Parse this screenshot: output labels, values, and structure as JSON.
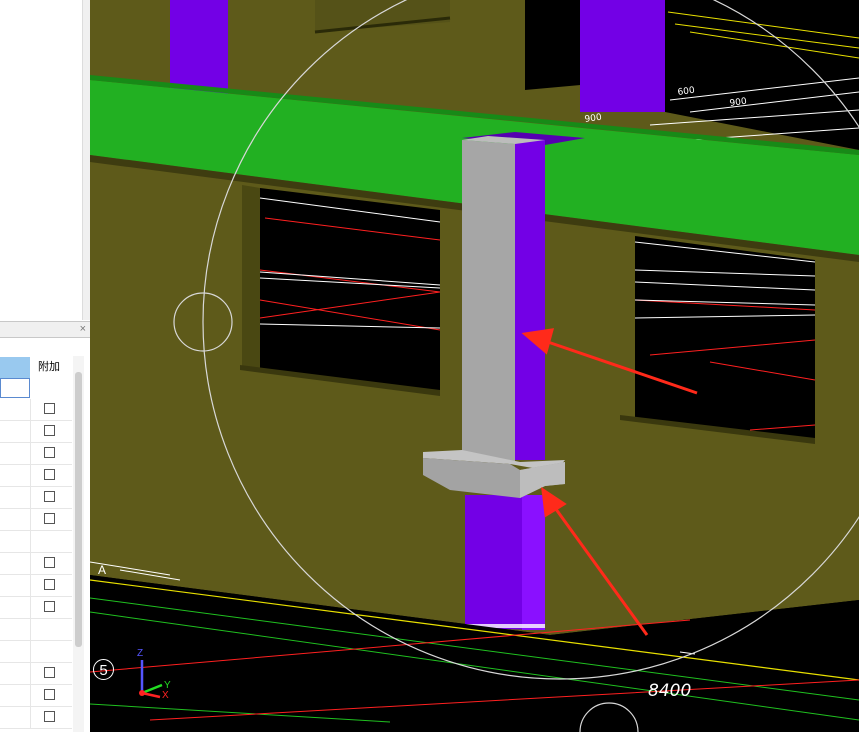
{
  "properties_panel": {
    "close_glyph": "×",
    "column_header_additional": "附加",
    "rows": [
      {
        "checkbox": true
      },
      {
        "checkbox": true
      },
      {
        "checkbox": true
      },
      {
        "checkbox": true
      },
      {
        "checkbox": true
      },
      {
        "checkbox": true
      },
      {
        "checkbox": false
      },
      {
        "checkbox": true
      },
      {
        "checkbox": true
      },
      {
        "checkbox": true
      },
      {
        "checkbox": false
      },
      {
        "checkbox": false
      },
      {
        "checkbox": true
      },
      {
        "checkbox": true
      },
      {
        "checkbox": true
      }
    ]
  },
  "viewport": {
    "dimension_label": "8400",
    "grid_axis_number": "5",
    "grid_axis_letter": "A",
    "axis_triad": {
      "z": "Z",
      "y": "Y",
      "x": "X"
    },
    "colors": {
      "wall": "#5e5a1a",
      "beam": "#22b022",
      "column": "#7300e6",
      "column_cap": "#a6a6a6",
      "arrow": "#ff2a1a",
      "background": "#000000"
    }
  }
}
